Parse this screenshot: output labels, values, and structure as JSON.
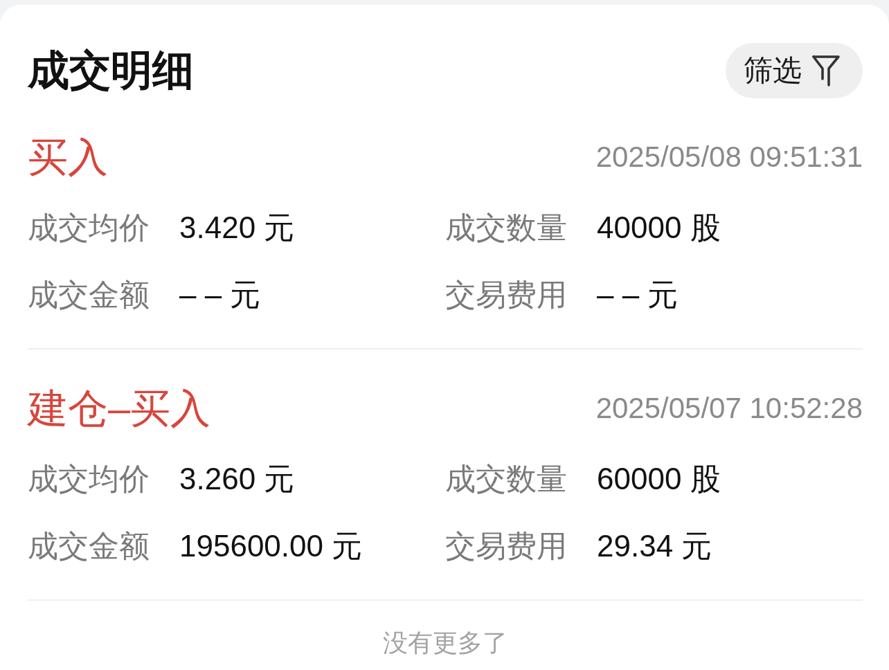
{
  "header": {
    "title": "成交明细",
    "filter_button": {
      "label": "筛选"
    }
  },
  "trades": [
    {
      "type": "买入",
      "time": "2025/05/08 09:51:31",
      "fields": [
        {
          "label": "成交均价",
          "value": "3.420 元"
        },
        {
          "label": "成交数量",
          "value": "40000 股"
        },
        {
          "label": "成交金额",
          "value": "– – 元"
        },
        {
          "label": "交易费用",
          "value": "– – 元"
        }
      ]
    },
    {
      "type": "建仓–买入",
      "time": "2025/05/07 10:52:28",
      "fields": [
        {
          "label": "成交均价",
          "value": "3.260 元"
        },
        {
          "label": "成交数量",
          "value": "60000 股"
        },
        {
          "label": "成交金额",
          "value": "195600.00 元"
        },
        {
          "label": "交易费用",
          "value": "29.34 元"
        }
      ]
    }
  ],
  "footer": {
    "end_note": "没有更多了"
  }
}
